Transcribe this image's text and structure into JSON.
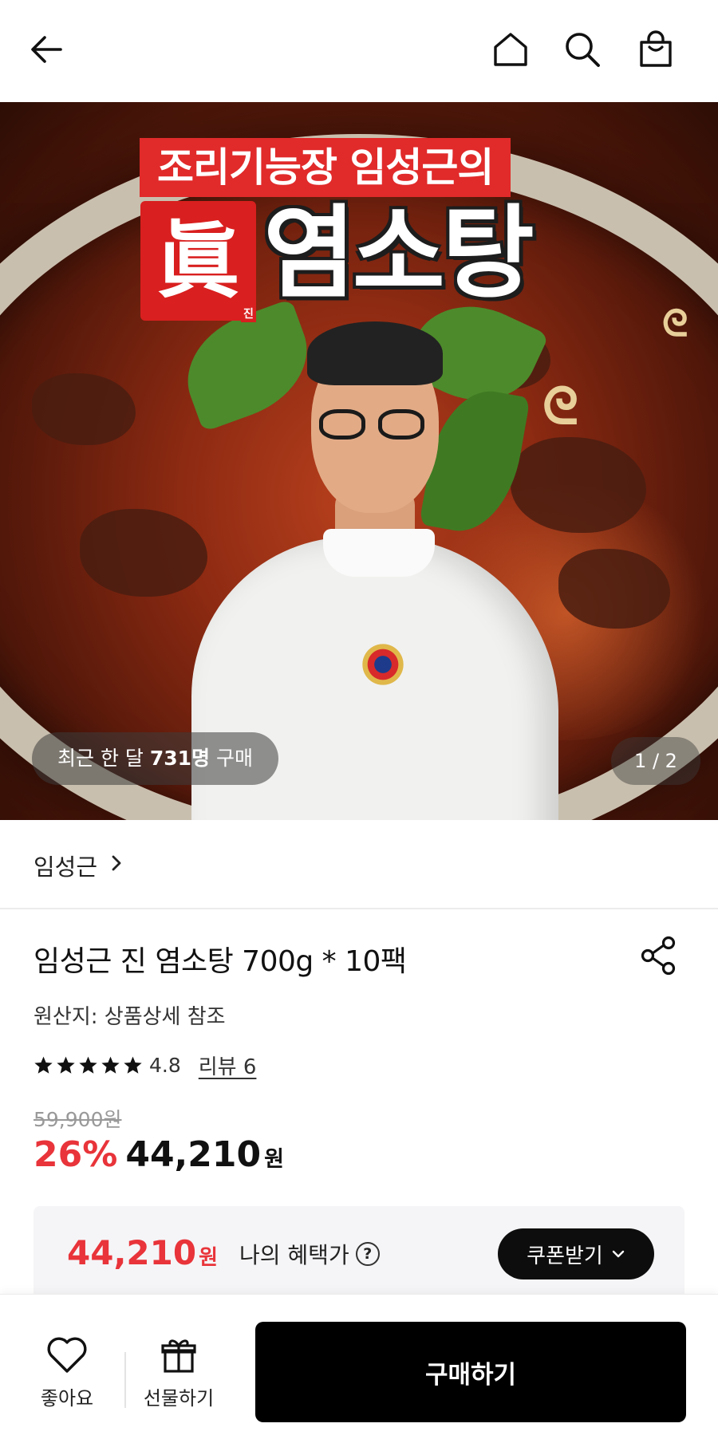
{
  "header": {
    "back_icon": "arrow-left-icon",
    "home_icon": "home-icon",
    "search_icon": "search-icon",
    "cart_icon": "shopping-bag-icon"
  },
  "hero": {
    "banner_line1": "조리기능장 임성근의",
    "banner_jin_hanja": "眞",
    "banner_jin_hangul": "진",
    "banner_title": "염소탕",
    "recent_prefix": "최근 한 달 ",
    "recent_count": "731명",
    "recent_suffix": " 구매",
    "page_indicator": "1 / 2",
    "current_page": 1,
    "total_pages": 2
  },
  "brand": {
    "name": "임성근"
  },
  "product": {
    "name": "임성근 진 염소탕 700g * 10팩",
    "origin": "원산지: 상품상세 참조",
    "rating": "4.8",
    "stars": 5,
    "reviews_label": "리뷰 6",
    "original_price": "59,900원",
    "discount": "26%",
    "sale_price": "44,210",
    "currency": "원"
  },
  "benefit": {
    "price": "44,210",
    "currency": "원",
    "label": "나의 혜택가",
    "help": "?",
    "coupon_button": "쿠폰받기"
  },
  "bottom_bar": {
    "like_label": "좋아요",
    "gift_label": "선물하기",
    "buy_label": "구매하기"
  },
  "colors": {
    "accent_red": "#e8343a",
    "button_black": "#000000",
    "benefit_bg": "#f5f5f7"
  }
}
